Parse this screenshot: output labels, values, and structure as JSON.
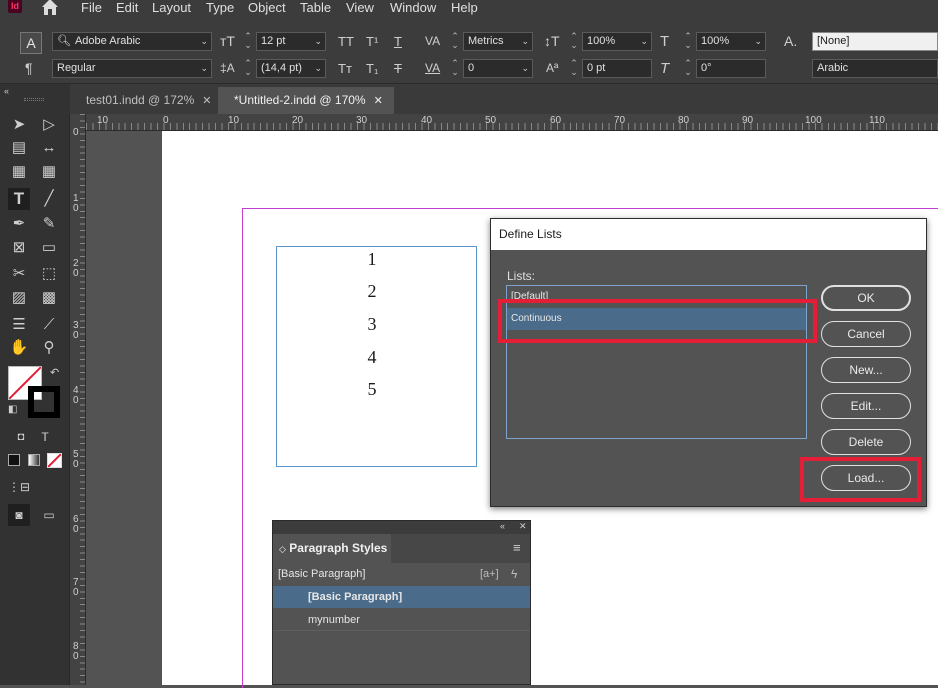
{
  "app": {
    "icon_label": "Id",
    "accent": "#ff3366"
  },
  "menu": [
    "File",
    "Edit",
    "Layout",
    "Type",
    "Object",
    "Table",
    "View",
    "Window",
    "Help"
  ],
  "control": {
    "font_family": "Adobe Arabic",
    "font_style": "Regular",
    "font_size": "12 pt",
    "leading": "(14,4 pt)",
    "kerning": "Metrics",
    "tracking": "0",
    "vscale": "100%",
    "hscale": "100%",
    "baseline": "0 pt",
    "skew": "0°",
    "char_style": "[None]",
    "language": "Arabic"
  },
  "tabs": [
    {
      "label": "test01.indd @ 172%",
      "active": false
    },
    {
      "label": "*Untitled-2.indd @ 170%",
      "active": true
    }
  ],
  "ruler_h": [
    "10",
    "0",
    "10",
    "20",
    "30",
    "40",
    "50",
    "60",
    "70",
    "80",
    "90",
    "100",
    "110"
  ],
  "ruler_v": [
    [
      "0"
    ],
    [
      "1",
      "0"
    ],
    [
      "2",
      "0"
    ],
    [
      "3",
      "0"
    ],
    [
      "4",
      "0"
    ],
    [
      "5",
      "0"
    ],
    [
      "6",
      "0"
    ],
    [
      "7",
      "0"
    ],
    [
      "8",
      "0"
    ]
  ],
  "page_numbers": [
    "1",
    "2",
    "3",
    "4",
    "5"
  ],
  "dialog": {
    "title": "Define Lists",
    "lists_label": "Lists:",
    "items": [
      {
        "label": "[Default]",
        "selected": false
      },
      {
        "label": "Continuous",
        "selected": true
      }
    ],
    "buttons": {
      "ok": "OK",
      "cancel": "Cancel",
      "new": "New...",
      "edit": "Edit...",
      "delete": "Delete",
      "load": "Load..."
    }
  },
  "paragraph_styles": {
    "title": "Paragraph Styles",
    "current": "[Basic Paragraph]",
    "items": [
      {
        "label": "[Basic Paragraph]",
        "selected": true
      },
      {
        "label": "mynumber",
        "selected": false
      }
    ]
  },
  "colors": {
    "highlight": "#e31e36",
    "selection": "#4a6b8a",
    "margin_guide": "#c13fcf",
    "frame": "#5b95c9"
  }
}
